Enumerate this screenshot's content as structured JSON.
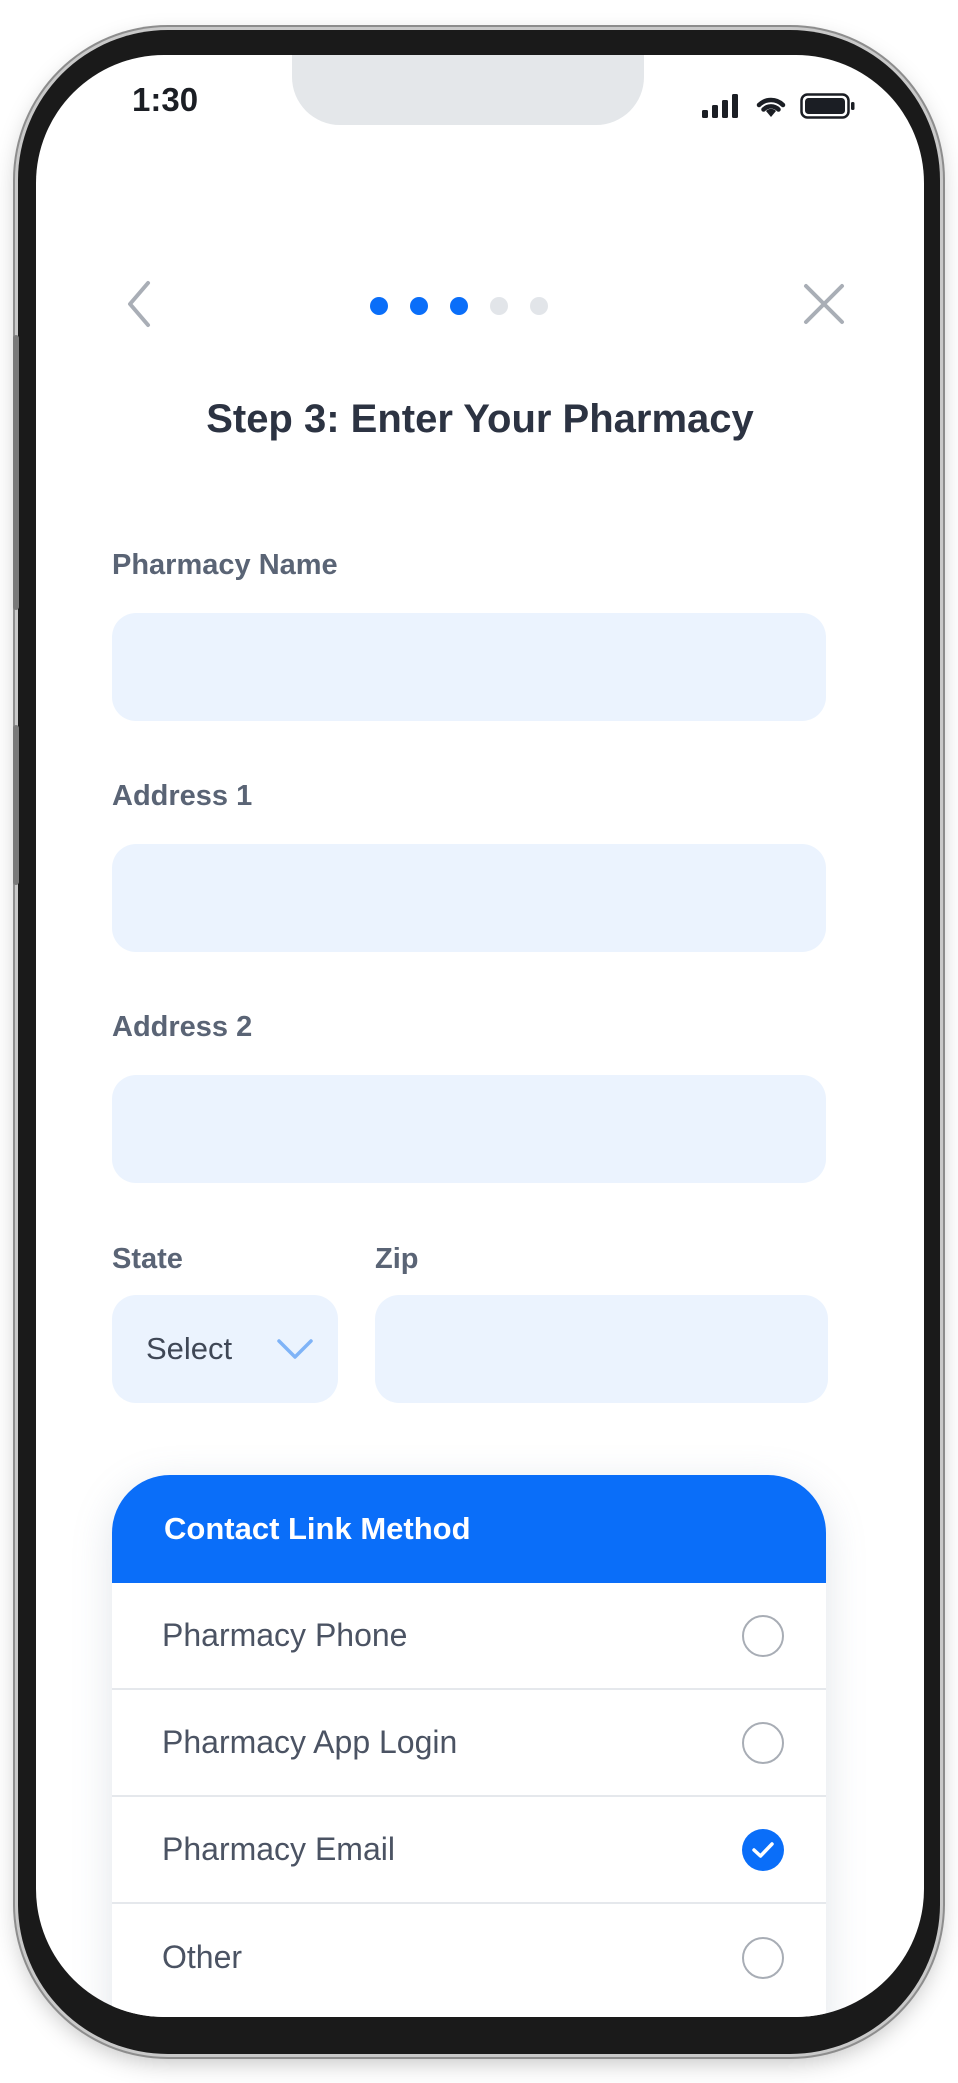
{
  "status_bar": {
    "time": "1:30",
    "icons": [
      "signal-icon",
      "wifi-icon",
      "battery-icon"
    ]
  },
  "nav": {
    "back_icon": "chevron-left-icon",
    "close_icon": "close-icon",
    "progress": {
      "total_steps": 5,
      "current_step": 3
    }
  },
  "page": {
    "title": "Step 3: Enter Your Pharmacy"
  },
  "form": {
    "pharmacy_name": {
      "label": "Pharmacy Name",
      "value": ""
    },
    "address1": {
      "label": "Address 1",
      "value": ""
    },
    "address2": {
      "label": "Address 2",
      "value": ""
    },
    "state": {
      "label": "State",
      "selected": "Select"
    },
    "zip": {
      "label": "Zip",
      "value": ""
    }
  },
  "contact": {
    "header": "Contact Link Method",
    "options": [
      {
        "label": "Pharmacy Phone",
        "checked": false
      },
      {
        "label": "Pharmacy App Login",
        "checked": false
      },
      {
        "label": "Pharmacy Email",
        "checked": true
      },
      {
        "label": "Other",
        "checked": false
      }
    ]
  },
  "colors": {
    "accent": "#0a6ef9",
    "dot_inactive": "#e2e5e9",
    "input_bg": "#ebf3fe",
    "label": "#5a6475",
    "title": "#2c3342"
  }
}
